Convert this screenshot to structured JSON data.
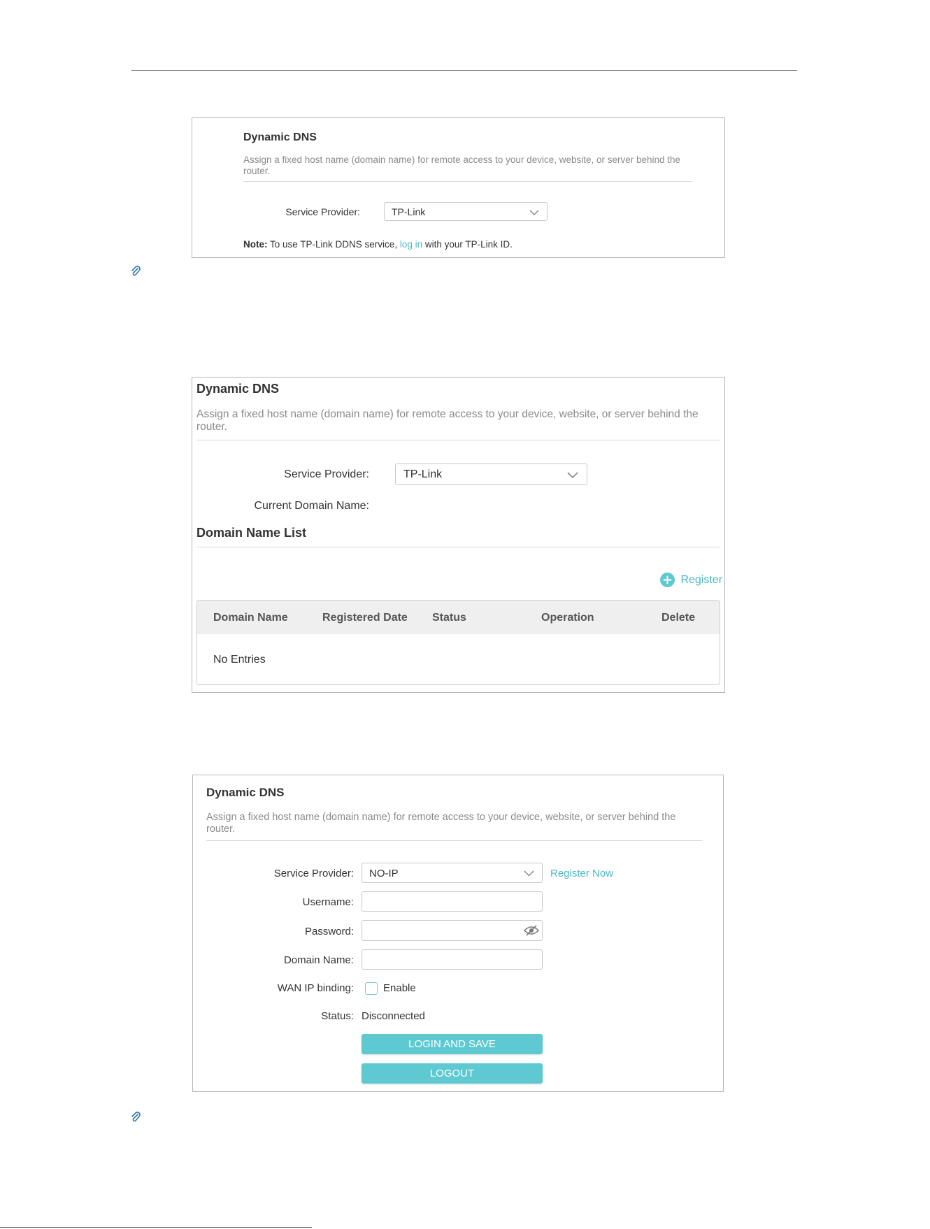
{
  "panel1": {
    "title": "Dynamic DNS",
    "description": "Assign a fixed host name (domain name) for remote access to your device, website, or server behind the router.",
    "service_provider_label": "Service Provider:",
    "service_provider_value": "TP-Link",
    "note_prefix": "Note:",
    "note_before_link": " To use TP-Link DDNS service, ",
    "note_link": "log in",
    "note_after_link": " with your TP-Link ID."
  },
  "panel2": {
    "title": "Dynamic DNS",
    "description": "Assign a fixed host name (domain name) for remote access to your device, website, or server behind the router.",
    "service_provider_label": "Service Provider:",
    "service_provider_value": "TP-Link",
    "current_domain_label": "Current Domain Name:",
    "list_title": "Domain Name List",
    "register_label": "Register",
    "table": {
      "headers": [
        "Domain Name",
        "Registered Date",
        "Status",
        "Operation",
        "Delete"
      ],
      "empty_text": "No Entries"
    }
  },
  "panel3": {
    "title": "Dynamic DNS",
    "description": "Assign a fixed host name (domain name) for remote access to your device, website, or server behind the router.",
    "service_provider_label": "Service Provider:",
    "service_provider_value": "NO-IP",
    "register_now": "Register Now",
    "username_label": "Username:",
    "username_value": "",
    "password_label": "Password:",
    "password_value": "",
    "domain_label": "Domain Name:",
    "domain_value": "",
    "wan_ip_label": "WAN IP binding:",
    "enable_label": "Enable",
    "status_label": "Status:",
    "status_value": "Disconnected",
    "login_save_button": "LOGIN AND SAVE",
    "logout_button": "LOGOUT"
  },
  "colors": {
    "accent": "#5ec9d1",
    "link": "#4ab8c8"
  },
  "icons": [
    "paperclip-icon",
    "chevron-down-icon",
    "plus-circle-icon",
    "eye-off-icon"
  ]
}
